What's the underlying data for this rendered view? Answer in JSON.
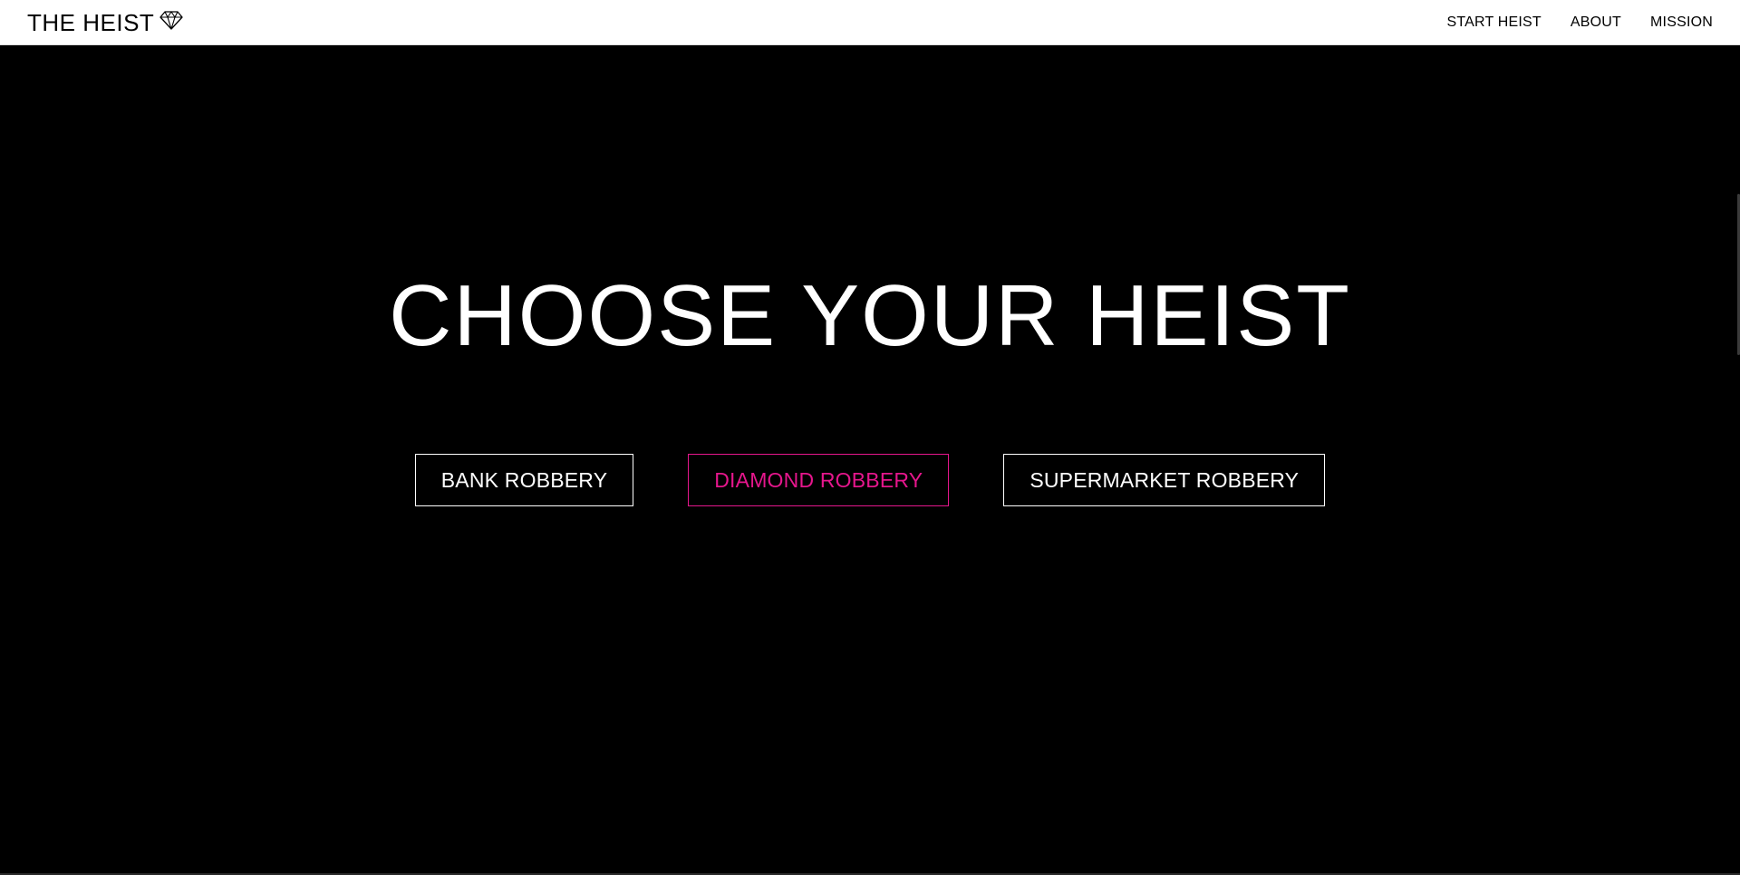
{
  "navbar": {
    "brand": "THE HEIST",
    "brand_icon": "diamond-icon",
    "links": [
      {
        "label": "START HEIST"
      },
      {
        "label": "ABOUT"
      },
      {
        "label": "MISSION"
      }
    ]
  },
  "hero": {
    "title": "CHOOSE YOUR HEIST",
    "options": [
      {
        "label": "BANK ROBBERY",
        "selected": false
      },
      {
        "label": "DIAMOND ROBBERY",
        "selected": true
      },
      {
        "label": "SUPERMARKET ROBBERY",
        "selected": false
      }
    ]
  },
  "colors": {
    "accent": "#e5168c",
    "background": "#000000",
    "navbar": "#ffffff",
    "text_light": "#ffffff"
  }
}
